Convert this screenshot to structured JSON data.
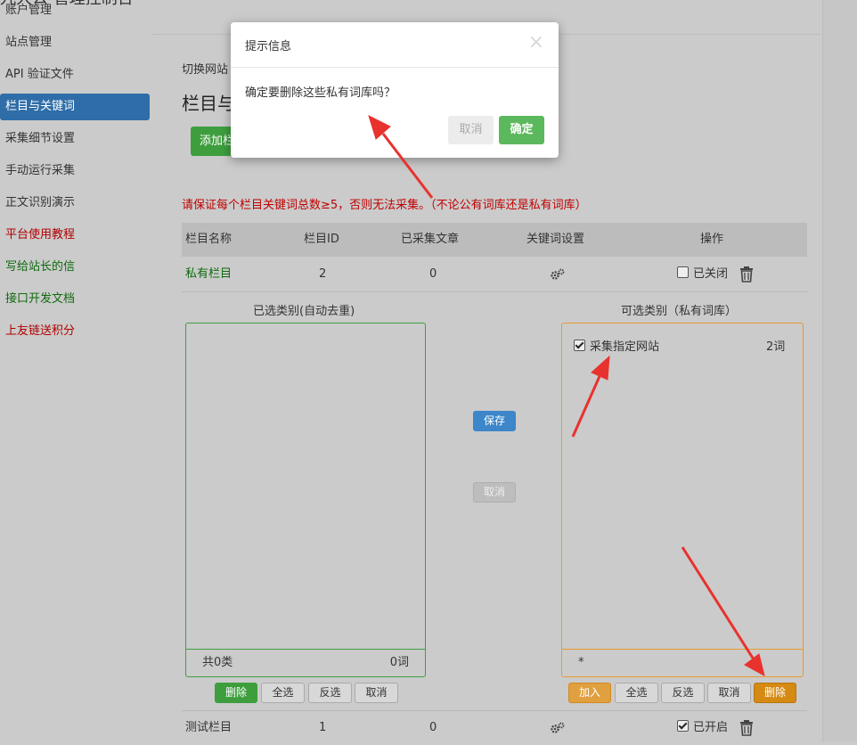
{
  "app": {
    "title": "九大公 管理控制台"
  },
  "sidebar": {
    "items": [
      {
        "label": "账户管理"
      },
      {
        "label": "站点管理"
      },
      {
        "label": "API 验证文件"
      },
      {
        "label": "栏目与关键词"
      },
      {
        "label": "采集细节设置"
      },
      {
        "label": "手动运行采集"
      },
      {
        "label": "正文识别演示"
      },
      {
        "label": "平台使用教程"
      },
      {
        "label": "写给站长的信"
      },
      {
        "label": "接口开发文档"
      },
      {
        "label": "上友链送积分"
      }
    ]
  },
  "main": {
    "breadcrumb": "切换网站",
    "title": "栏目与",
    "add_button": "添加栏",
    "warning": "请保证每个栏目关键词总数≥5，否则无法采集。（不论公有词库还是私有词库）",
    "table": {
      "headers": [
        "栏目名称",
        "栏目ID",
        "已采集文章",
        "关键词设置",
        "操作"
      ],
      "rows": [
        {
          "name": "私有栏目",
          "id": "2",
          "articles": "0",
          "status": "已关闭"
        },
        {
          "name": "测试栏目",
          "id": "1",
          "articles": "0",
          "status": "已开启"
        }
      ]
    },
    "selected_panel": {
      "title": "已选类别(自动去重)",
      "footer_left": "共0类",
      "footer_right": "0词",
      "buttons": [
        "删除",
        "全选",
        "反选",
        "取消"
      ]
    },
    "middle": {
      "save": "保存",
      "cancel": "取消"
    },
    "available_panel": {
      "title": "可选类别（私有词库）",
      "items": [
        {
          "label": "采集指定网站",
          "count": "2词"
        }
      ],
      "footer_left": "*",
      "buttons": [
        "加入",
        "全选",
        "反选",
        "取消",
        "删除"
      ]
    }
  },
  "modal": {
    "title": "提示信息",
    "close": "×",
    "message": "确定要删除这些私有词库吗？",
    "cancel": "取消",
    "ok": "确定"
  },
  "colors": {
    "active": "#2f6da8",
    "green": "#3e9e3e",
    "orange": "#e89a30",
    "warning": "#c00000",
    "arrow": "#e8322e"
  }
}
